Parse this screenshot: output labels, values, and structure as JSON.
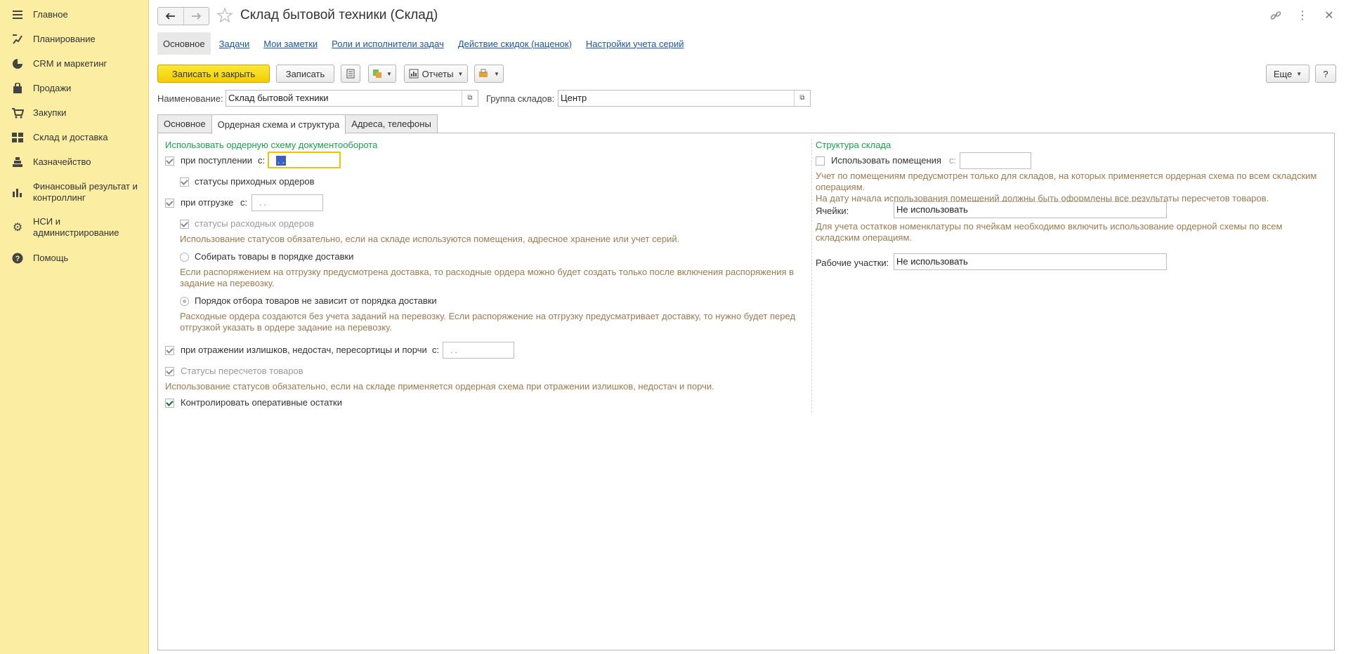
{
  "sidebar": {
    "items": [
      {
        "icon": "menu-icon",
        "label": "Главное"
      },
      {
        "icon": "planning-icon",
        "label": "Планирование"
      },
      {
        "icon": "pie-chart-icon",
        "label": "CRM и маркетинг"
      },
      {
        "icon": "shopping-bag-icon",
        "label": "Продажи"
      },
      {
        "icon": "cart-icon",
        "label": "Закупки"
      },
      {
        "icon": "warehouse-grid-icon",
        "label": "Склад и доставка"
      },
      {
        "icon": "treasury-icon",
        "label": "Казначейство"
      },
      {
        "icon": "bar-chart-icon",
        "label": "Финансовый результат и контроллинг"
      },
      {
        "icon": "gear-icon",
        "label": "НСИ и администрирование"
      },
      {
        "icon": "help-icon",
        "label": "Помощь"
      }
    ]
  },
  "header": {
    "title": "Склад бытовой техники (Склад)"
  },
  "navtabs": [
    "Основное",
    "Задачи",
    "Мои заметки",
    "Роли и исполнители задач",
    "Действие скидок (наценок)",
    "Настройки учета серий"
  ],
  "toolbar": {
    "save_close": "Записать и закрыть",
    "save": "Записать",
    "reports": "Отчеты",
    "more": "Еще",
    "help": "?"
  },
  "fields": {
    "name_label": "Наименование:",
    "name_value": "Склад бытовой техники",
    "group_label": "Группа складов:",
    "group_value": "Центр"
  },
  "tabs": [
    "Основное",
    "Ордерная схема и структура",
    "Адреса, телефоны"
  ],
  "left": {
    "group_title": "Использовать ордерную схему документооборота",
    "on_receipt": "при поступлении",
    "from_label": "с:",
    "date_placeholder": ". .",
    "receipt_statuses": "статусы приходных ордеров",
    "on_shipment": "при отгрузке",
    "shipment_statuses": "статусы расходных ордеров",
    "statuses_note": "Использование статусов обязательно, если на складе используются помещения, адресное хранение или учет серий.",
    "collect_by_delivery": "Собирать товары в порядке доставки",
    "collect_note": "Если распоряжением на отгрузку предусмотрена доставка, то расходные ордера можно будет создать только после включения распоряжения в задание на перевозку.",
    "independent_order": "Порядок отбора товаров не зависит от порядка доставки",
    "independent_note": "Расходные ордера создаются без учета заданий на перевозку. Если распоряжение на отгрузку предусматривает доставку, то нужно будет перед отгрузкой указать в ордере задание на перевозку.",
    "on_surplus": "при отражении излишков, недостач, пересортицы и порчи",
    "recount_statuses": "Статусы пересчетов товаров",
    "recount_note": "Использование статусов обязательно, если на складе применяется ордерная схема при отражении излишков, недостач и порчи.",
    "control_balances": "Контролировать оперативные остатки"
  },
  "right": {
    "group_title": "Структура склада",
    "use_premises": "Использовать помещения",
    "from_label": "с:",
    "premises_note": "Учет по помещениям предусмотрен только для складов, на которых применяется ордерная схема по всем складским операциям.\nНа дату начала использования помещений должны быть оформлены все результаты пересчетов товаров.",
    "cells_label": "Ячейки:",
    "cells_value": "Не использовать",
    "cells_note": "Для учета остатков номенклатуры по ячейкам необходимо включить использование ордерной схемы по всем складским операциям.",
    "work_areas_label": "Рабочие участки:",
    "work_areas_value": "Не использовать"
  }
}
